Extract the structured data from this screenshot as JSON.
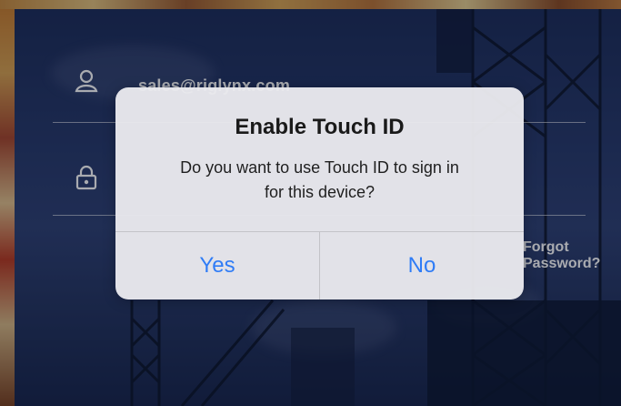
{
  "login": {
    "email_value": "sales@riglynx.com",
    "forgot_label": "Forgot Password?"
  },
  "alert": {
    "title": "Enable Touch ID",
    "message_line1": "Do you want to use Touch ID to sign in",
    "message_line2": "for this device?",
    "yes_label": "Yes",
    "no_label": "No"
  },
  "icons": {
    "user": "user-icon",
    "lock": "lock-icon"
  },
  "colors": {
    "sky": "#26386a",
    "alert_bg": "#eaeaee",
    "button_text": "#2f7cf6"
  }
}
